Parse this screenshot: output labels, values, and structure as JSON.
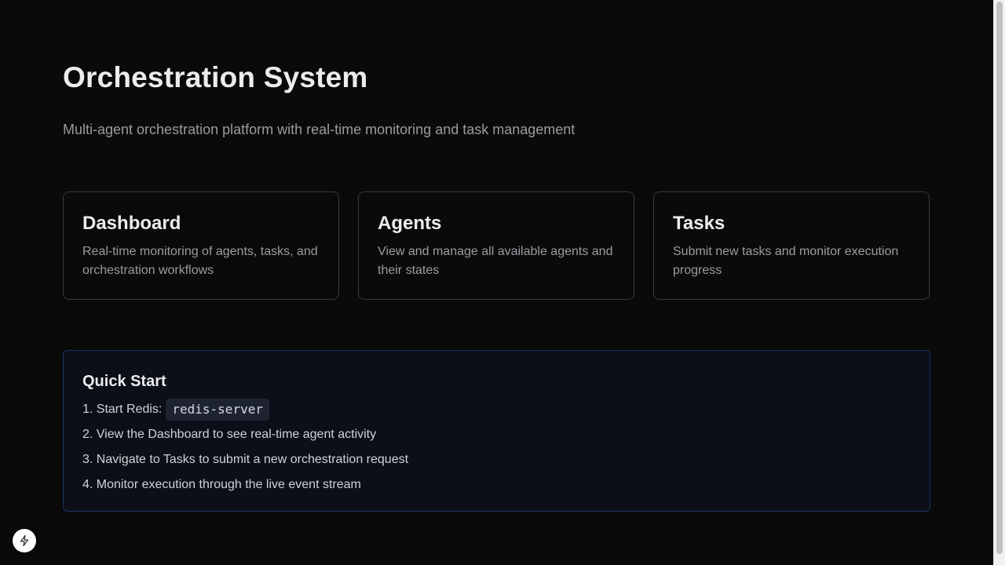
{
  "header": {
    "title": "Orchestration System",
    "subtitle": "Multi-agent orchestration platform with real-time monitoring and task management"
  },
  "cards": [
    {
      "title": "Dashboard",
      "description": "Real-time monitoring of agents, tasks, and orchestration workflows"
    },
    {
      "title": "Agents",
      "description": "View and manage all available agents and their states"
    },
    {
      "title": "Tasks",
      "description": "Submit new tasks and monitor execution progress"
    }
  ],
  "quick_start": {
    "title": "Quick Start",
    "steps": [
      {
        "text": "1. Start Redis:",
        "code": "redis-server"
      },
      {
        "text": "2. View the Dashboard to see real-time agent activity"
      },
      {
        "text": "3. Navigate to Tasks to submit a new orchestration request"
      },
      {
        "text": "4. Monitor execution through the live event stream"
      }
    ]
  },
  "dev_indicator": {
    "icon": "lightning-bolt-icon"
  },
  "colors": {
    "background": "#0a0a0b",
    "card_border": "#3a3a40",
    "quick_start_border": "#1f3263",
    "quick_start_background": "#0c0f18",
    "code_background": "#1d2331"
  }
}
